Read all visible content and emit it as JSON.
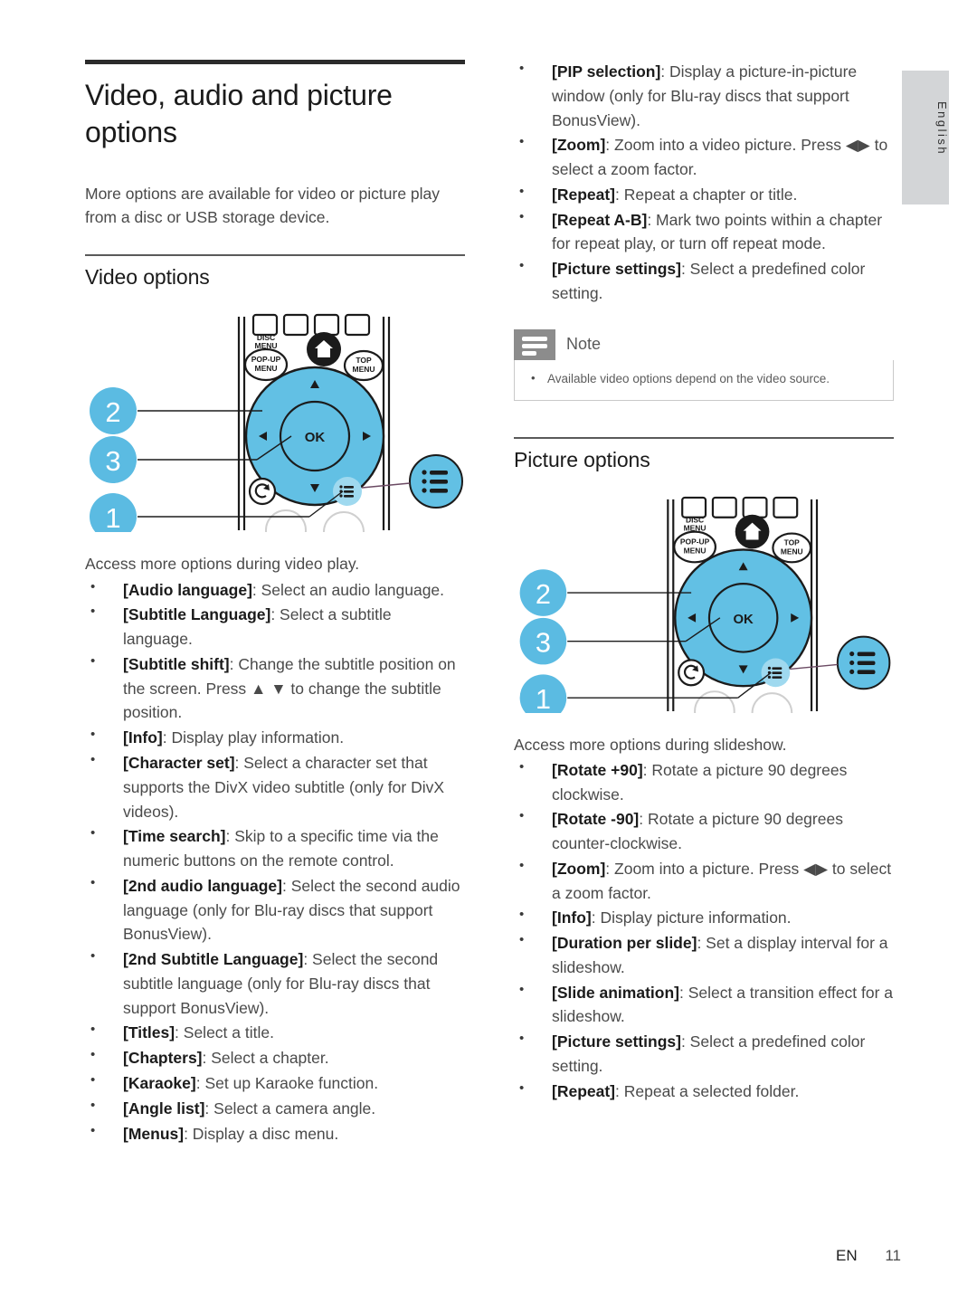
{
  "language_tab": {
    "label": "English"
  },
  "document": {
    "title": "Video, audio and picture options",
    "lead": "More options are available for video or picture play from a disc or USB storage device."
  },
  "video_section": {
    "heading": "Video options",
    "intro": "Access more options during video play.",
    "figure": {
      "name": "remote-control-video-options",
      "callouts": [
        "2",
        "3",
        "1"
      ],
      "button_labels": {
        "disc_menu": "DISC MENU",
        "popup_menu": "POP-UP MENU",
        "top_menu": "TOP MENU",
        "ok": "OK"
      },
      "icons": [
        "home-icon",
        "back-icon",
        "options-icon",
        "nav-up-icon",
        "nav-down-icon",
        "nav-left-icon",
        "nav-right-icon"
      ]
    },
    "options": [
      {
        "term": "[Audio language]",
        "desc": ": Select an audio language."
      },
      {
        "term": "[Subtitle Language]",
        "desc": ": Select a subtitle language."
      },
      {
        "term": "[Subtitle shift]",
        "desc": ": Change the subtitle position on the screen. Press ▲ ▼ to change the subtitle position."
      },
      {
        "term": "[Info]",
        "desc": ": Display play information."
      },
      {
        "term": "[Character set]",
        "desc": ": Select a character set that supports the DivX video subtitle (only for DivX videos)."
      },
      {
        "term": "[Time search]",
        "desc": ": Skip to a specific time via the numeric buttons on the remote control."
      },
      {
        "term": "[2nd audio language]",
        "desc": ": Select the second audio language (only for Blu-ray discs that support BonusView)."
      },
      {
        "term": "[2nd Subtitle Language]",
        "desc": ": Select the second subtitle language (only for Blu-ray discs that support BonusView)."
      },
      {
        "term": "[Titles]",
        "desc": ": Select a title."
      },
      {
        "term": "[Chapters]",
        "desc": ": Select a chapter."
      },
      {
        "term": "[Karaoke]",
        "desc": ": Set up Karaoke function."
      },
      {
        "term": "[Angle list]",
        "desc": ": Select a camera angle."
      },
      {
        "term": "[Menus]",
        "desc": ": Display a disc menu."
      }
    ]
  },
  "video_options_continued": [
    {
      "term": "[PIP selection]",
      "desc": ": Display a picture-in-picture window (only for Blu-ray discs that support BonusView)."
    },
    {
      "term": "[Zoom]",
      "desc": ": Zoom into a video picture. Press ◀▶ to select a zoom factor."
    },
    {
      "term": "[Repeat]",
      "desc": ": Repeat a chapter or title."
    },
    {
      "term": "[Repeat A-B]",
      "desc": ": Mark two points within a chapter for repeat play, or turn off repeat mode."
    },
    {
      "term": "[Picture settings]",
      "desc": ": Select a predefined color setting."
    }
  ],
  "note": {
    "title": "Note",
    "items": [
      "Available video options depend on the video source."
    ]
  },
  "picture_section": {
    "heading": "Picture options",
    "intro": "Access more options during slideshow.",
    "figure": {
      "name": "remote-control-picture-options",
      "callouts": [
        "2",
        "3",
        "1"
      ],
      "button_labels": {
        "disc_menu": "DISC MENU",
        "popup_menu": "POP-UP MENU",
        "top_menu": "TOP MENU",
        "ok": "OK"
      },
      "icons": [
        "home-icon",
        "back-icon",
        "options-icon",
        "nav-up-icon",
        "nav-down-icon",
        "nav-left-icon",
        "nav-right-icon"
      ]
    },
    "options": [
      {
        "term": "[Rotate +90]",
        "desc": ": Rotate a picture 90 degrees clockwise."
      },
      {
        "term": "[Rotate -90]",
        "desc": ": Rotate a picture 90 degrees counter-clockwise."
      },
      {
        "term": "[Zoom]",
        "desc": ": Zoom into a picture. Press ◀▶ to select a zoom factor."
      },
      {
        "term": "[Info]",
        "desc": ": Display picture information."
      },
      {
        "term": "[Duration per slide]",
        "desc": ": Set a display interval for a slideshow."
      },
      {
        "term": "[Slide animation]",
        "desc": ": Select a transition effect for a slideshow."
      },
      {
        "term": "[Picture settings]",
        "desc": ": Select a predefined color setting."
      },
      {
        "term": "[Repeat]",
        "desc": ": Repeat a selected folder."
      }
    ]
  },
  "footer": {
    "language_code": "EN",
    "page_number": "11"
  },
  "colors": {
    "accent_blue": "#62c0e4",
    "callout_blue": "#5bbbe2",
    "note_gray": "#8c8c8c",
    "tab_gray": "#d3d5d7",
    "text_dark": "#1b1b1b",
    "text_body": "#4a4a4a"
  }
}
